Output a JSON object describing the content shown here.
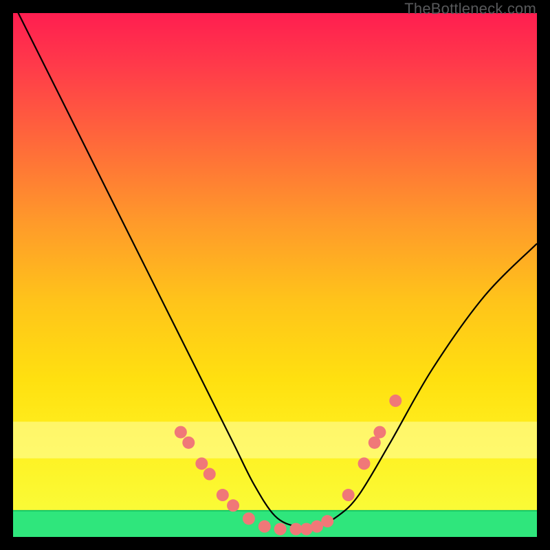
{
  "watermark": "TheBottleneck.com",
  "chart_data": {
    "type": "line",
    "title": "",
    "xlabel": "",
    "ylabel": "",
    "xlim": [
      0,
      100
    ],
    "ylim": [
      0,
      100
    ],
    "grid": false,
    "background_gradient": {
      "top": "#ff1e50",
      "mid": "#ffd400",
      "bottom": "#2fe67c"
    },
    "series": [
      {
        "name": "bottleneck-curve",
        "x": [
          0,
          6,
          12,
          18,
          24,
          30,
          36,
          42,
          46,
          50,
          54,
          58,
          62,
          66,
          72,
          80,
          90,
          100
        ],
        "y": [
          102,
          90,
          78,
          66,
          54,
          42,
          30,
          18,
          10,
          4,
          2,
          2,
          4,
          8,
          18,
          32,
          46,
          56
        ]
      }
    ],
    "highlight_points": {
      "name": "salmon-dots",
      "color": "#f07878",
      "points": [
        {
          "x": 32,
          "y": 20
        },
        {
          "x": 33.5,
          "y": 18
        },
        {
          "x": 36,
          "y": 14
        },
        {
          "x": 37.5,
          "y": 12
        },
        {
          "x": 40,
          "y": 8
        },
        {
          "x": 42,
          "y": 6
        },
        {
          "x": 45,
          "y": 3.5
        },
        {
          "x": 48,
          "y": 2
        },
        {
          "x": 51,
          "y": 1.5
        },
        {
          "x": 54,
          "y": 1.5
        },
        {
          "x": 56,
          "y": 1.5
        },
        {
          "x": 58,
          "y": 2
        },
        {
          "x": 60,
          "y": 3
        },
        {
          "x": 64,
          "y": 8
        },
        {
          "x": 67,
          "y": 14
        },
        {
          "x": 69,
          "y": 18
        },
        {
          "x": 70,
          "y": 20
        },
        {
          "x": 73,
          "y": 26
        }
      ]
    },
    "green_band": {
      "from_y": 0,
      "to_y": 5
    },
    "pale_band": {
      "from_y": 15,
      "to_y": 22
    }
  }
}
